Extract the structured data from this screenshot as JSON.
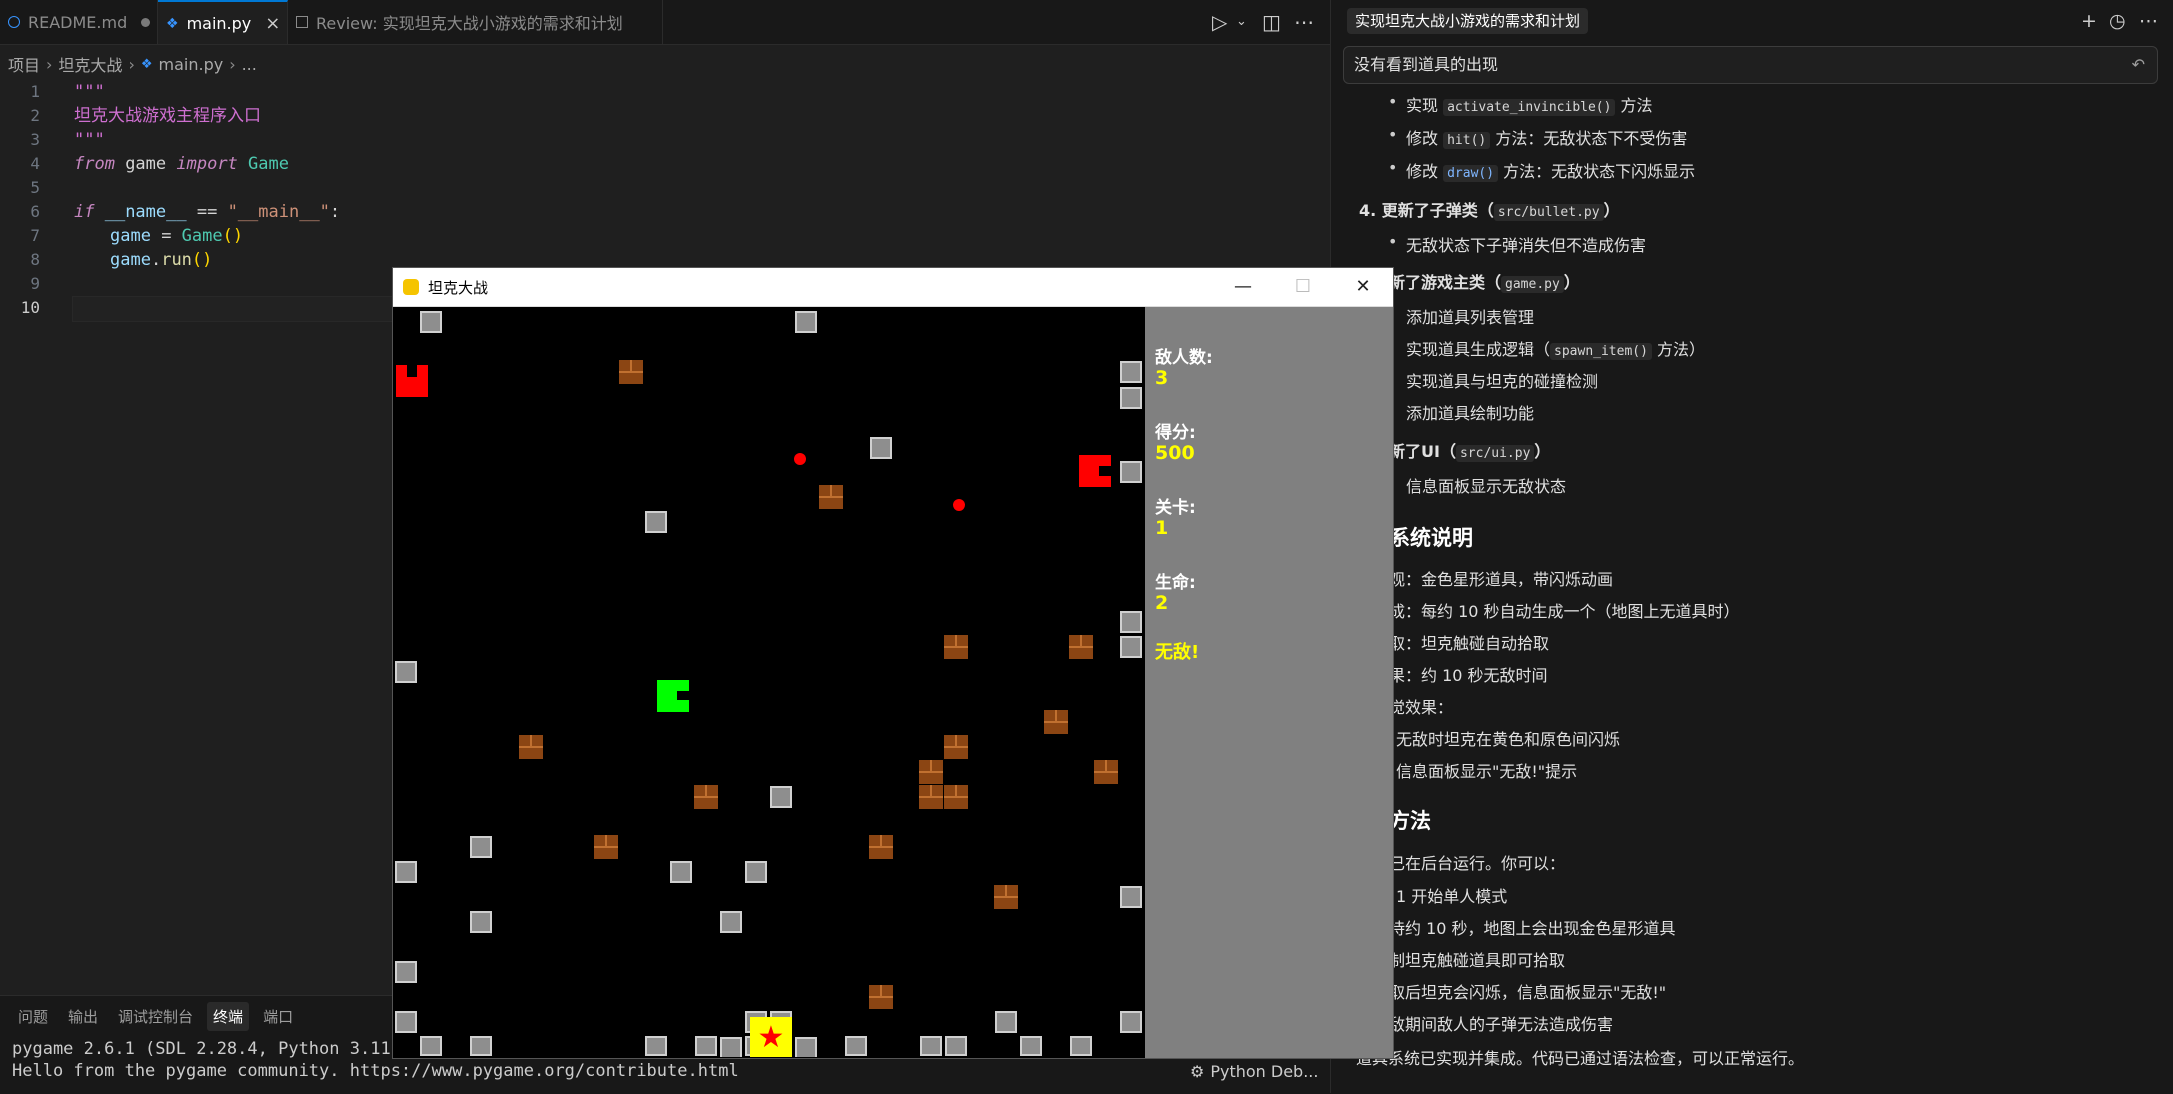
{
  "tabs": [
    {
      "label": "README.md"
    },
    {
      "label": "main.py"
    },
    {
      "label": "Review: 实现坦克大战小游戏的需求和计划"
    }
  ],
  "breadcrumb": [
    "项目",
    "坦克大战",
    "main.py",
    "..."
  ],
  "editor": {
    "current_line": 10,
    "lines": [
      {
        "n": "1"
      },
      {
        "n": "2"
      },
      {
        "n": "3"
      },
      {
        "n": "4"
      },
      {
        "n": "5"
      },
      {
        "n": "6"
      },
      {
        "n": "7"
      },
      {
        "n": "8"
      },
      {
        "n": "9"
      },
      {
        "n": "10"
      }
    ],
    "code": {
      "l1": "\"\"\"",
      "l2": "坦克大战游戏主程序入口",
      "l3": "\"\"\"",
      "l4_from": "from",
      "l4_mod": " game ",
      "l4_import": "import",
      "l4_cls": " Game",
      "l6_if": "if",
      "l6_name": " __name__",
      "l6_eq": " == ",
      "l6_str": "\"__main__\"",
      "l6_colon": ":",
      "l7_var": "game",
      "l7_eq": " = ",
      "l7_cls": "Game",
      "l7_paren": "()",
      "l8_var": "game",
      "l8_dot": ".",
      "l8_fn": "run",
      "l8_paren": "()"
    }
  },
  "panel": {
    "tabs": [
      "问题",
      "输出",
      "调试控制台",
      "终端",
      "端口"
    ],
    "active_tab": "终端",
    "terminal_lines": [
      "pygame 2.6.1 (SDL 2.28.4, Python 3.11.7)",
      "Hello from the pygame community. https://www.pygame.org/contribute.html"
    ],
    "python_debug": "Python Deb..."
  },
  "chat": {
    "title": "实现坦克大战小游戏的需求和计划",
    "input_value": "没有看到道具的出现",
    "icons": [
      "plus-icon",
      "history-icon",
      "more-icon"
    ]
  },
  "chat_lines": {
    "c1a": "实现 ",
    "c1b": "activate_invincible()",
    "c1c": " 方法",
    "c2a": "修改 ",
    "c2b": "hit()",
    "c2c": " 方法：无敌状态下不受伤害",
    "c3a": "修改 ",
    "c3b": "draw()",
    "c3c": " 方法：无敌状态下闪烁显示",
    "c4a": "4. 更新了子弹类",
    "c4b": "src/bullet.py",
    "c5": "无敌状态下子弹消失但不造成伤害",
    "c6a": "新了游戏主类",
    "c6b": "game.py",
    "c7": "添加道具列表管理",
    "c8a": "实现道具生成逻辑（",
    "c8b": "spawn_item()",
    "c8c": " 方法）",
    "c9": "实现道具与坦克的碰撞检测",
    "c10": "添加道具绘制功能",
    "c11a": "新了UI",
    "c11b": "src/ui.py",
    "c12": "信息面板显示无敌状态",
    "c13": "系统说明",
    "c14": "观：金色星形道具，带闪烁动画",
    "c15": "成：每约 10 秒自动生成一个（地图上无道具时）",
    "c16": "取：坦克触碰自动拾取",
    "c17": "果：约 10 秒无敌时间",
    "c18": "觉效果：",
    "c19": "无敌时坦克在黄色和原色间闪烁",
    "c20": "信息面板显示\"无敌!\"提示",
    "c21": "方法",
    "c22": "已在后台运行。你可以：",
    "c23": "1 开始单人模式",
    "c24": "待约 10 秒，地图上会出现金色星形道具",
    "c25": "制坦克触碰道具即可拾取",
    "c26": "取后坦克会闪烁，信息面板显示\"无敌!\"",
    "c27": "敌期间敌人的子弹无法造成伤害",
    "c28": "道具系统已实现并集成。代码已通过语法检查，可以正常运行。"
  },
  "game_window": {
    "title": "坦克大战",
    "info": {
      "enemies_label": "敌人数:",
      "enemies_value": "3",
      "score_label": "得分:",
      "score_value": "500",
      "level_label": "关卡:",
      "level_value": "1",
      "lives_label": "生命:",
      "lives_value": "2",
      "invincible_text": "无敌!"
    },
    "colors": {
      "player_tank": "#00ff00",
      "enemy_tank": "#ff0000",
      "item": "#ffff00",
      "panel_bg": "#808080",
      "text": "#ffff00"
    }
  }
}
